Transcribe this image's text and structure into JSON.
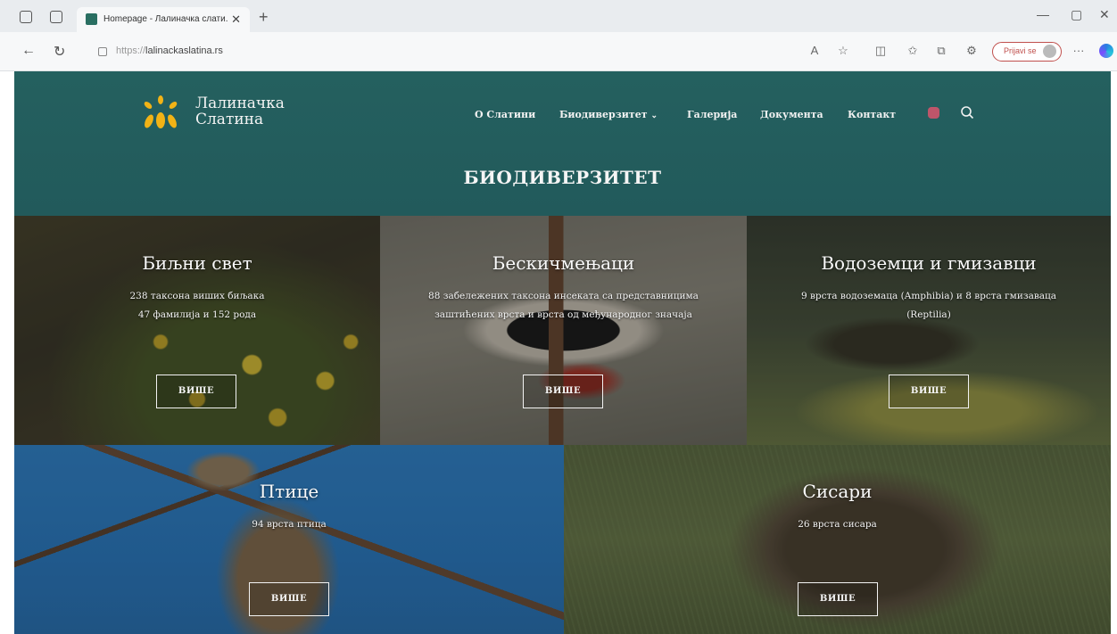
{
  "browser": {
    "tab_title": "Homepage - Лалиначка слати...",
    "url_prefix": "https://",
    "url_host": "lalinackaslatina.rs",
    "profile_label": "Prijavi se",
    "colors": {
      "tab_favicon": "#2a6f62",
      "profile_accent": "#c0504d"
    }
  },
  "site": {
    "logo_line1": "Лалиначка",
    "logo_line2": "Слатина",
    "nav": [
      {
        "label": "О Слатини"
      },
      {
        "label": "Биодиверзитет"
      },
      {
        "label": "Галерија"
      },
      {
        "label": "Документа"
      },
      {
        "label": "Контакт"
      }
    ],
    "page_title": "БИОДИВЕРЗИТЕТ",
    "more_label": "ВИШЕ",
    "colors": {
      "header_bg": "#22585c",
      "logo_yellow": "#f2b316"
    }
  },
  "cards": [
    {
      "title": "Биљни свет",
      "line1": "238 таксона виших биљака",
      "line2": "47 фамилија и 152 рода"
    },
    {
      "title": "Бескичмењаци",
      "line1": "88 забележених таксона инсеката са представницима",
      "line2": "заштићених врста и врста од међународног значаја"
    },
    {
      "title": "Водоземци и гмизавци",
      "line1": "9 врста водоземаца (Amphibia) и 8 врста гмизаваца",
      "line2": "(Reptilia)"
    },
    {
      "title": "Птице",
      "line1": "94 врста птица",
      "line2": ""
    },
    {
      "title": "Сисари",
      "line1": "26 врста сисара",
      "line2": ""
    }
  ]
}
